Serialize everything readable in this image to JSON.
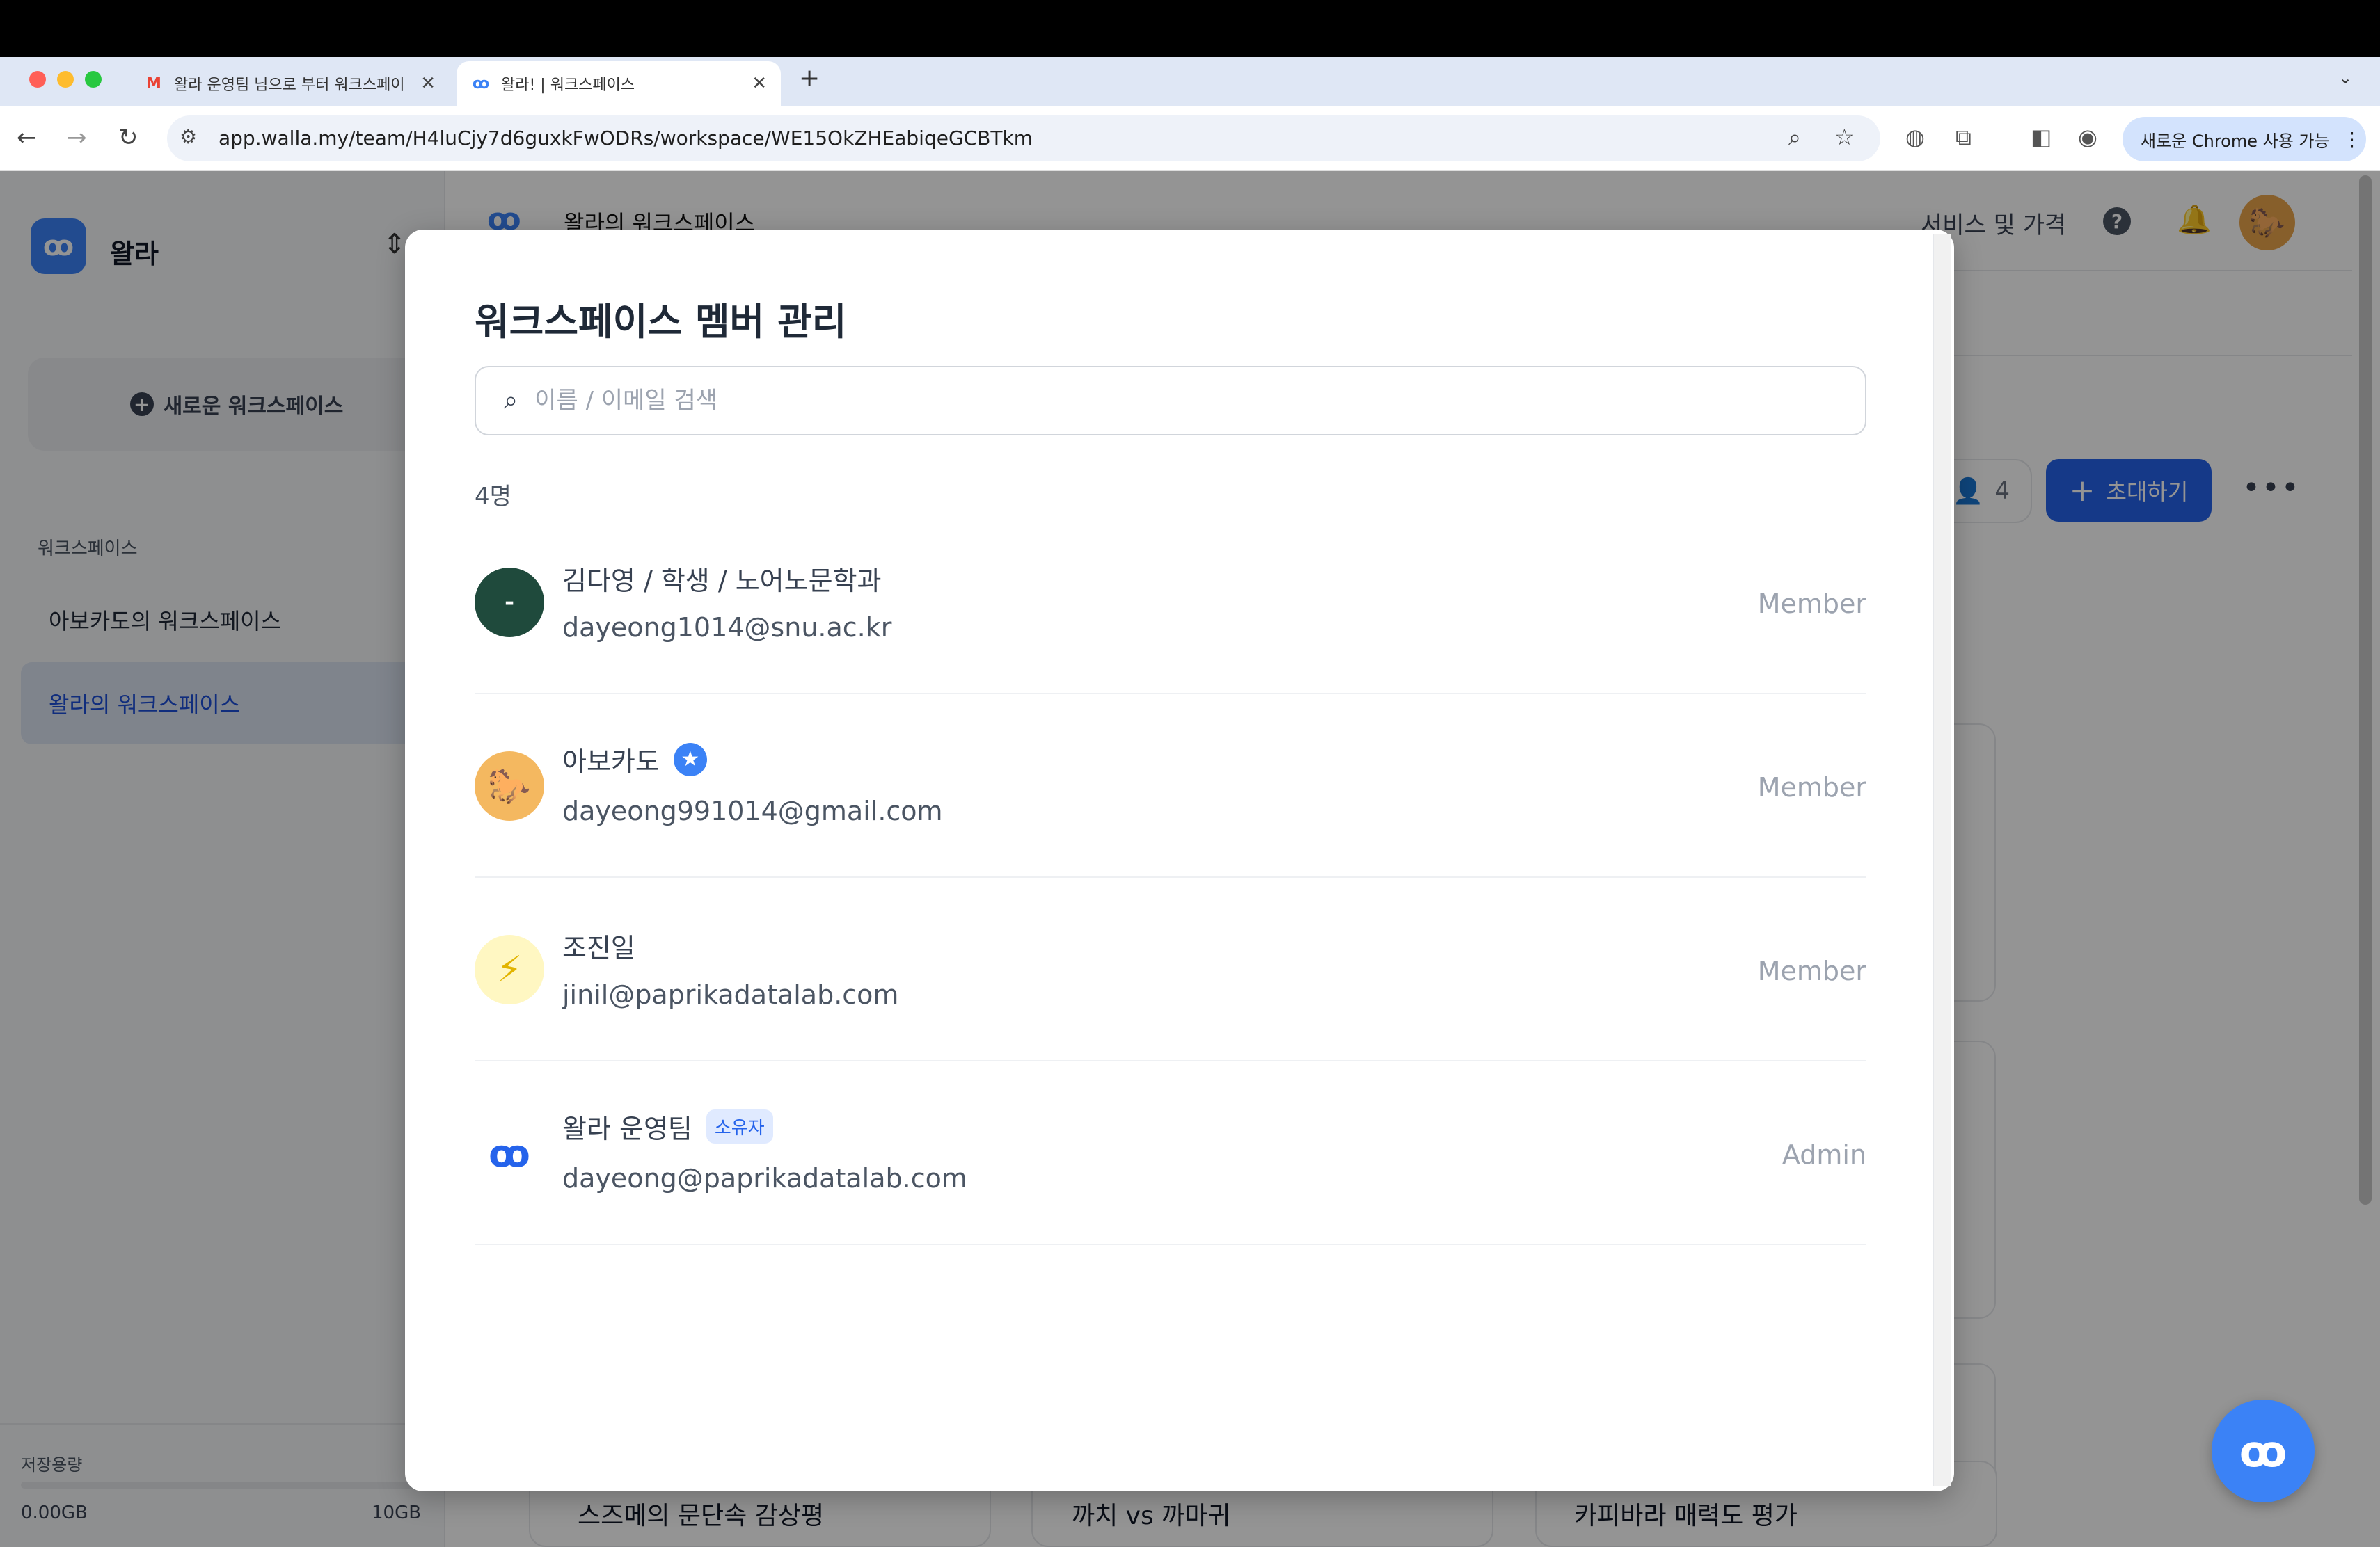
{
  "browser": {
    "tabs": [
      {
        "title": "왈라 운영팀 님으로 부터 워크스페이",
        "favicon": "M"
      },
      {
        "title": "왈라! | 워크스페이스",
        "favicon": "ꝏ"
      }
    ],
    "url": "app.walla.my/team/H4luCjy7d6guxkFwODRs/workspace/WE15OkZHEabiqeGCBTkm",
    "chrome_button": "새로운 Chrome 사용 가능"
  },
  "sidebar": {
    "logo_icon": "ꝏ",
    "brand": "왈라",
    "new_workspace": "새로운 워크스페이스",
    "section_label": "워크스페이스",
    "items": [
      {
        "label": "아보카도의 워크스페이스"
      },
      {
        "label": "왈라의 워크스페이스"
      }
    ],
    "storage_label": "저장용량",
    "storage_used": "0.00GB",
    "storage_total": "10GB",
    "storage_fraction": 0.0
  },
  "header": {
    "logo": "ꝏ",
    "workspace_title": "왈라의 워크스페이스",
    "pricing": "서비스 및 가격",
    "help": "?"
  },
  "toolbar": {
    "member_count": "4",
    "invite_label": "초대하기",
    "more": "•••"
  },
  "cards": [
    "스즈메의 문단속 감상평",
    "까치 vs 까마귀",
    "카피바라 매력도 평가"
  ],
  "fab_icon": "ꝏ",
  "modal": {
    "title": "워크스페이스 멤버 관리",
    "search_placeholder": "이름 / 이메일 검색",
    "count": "4명",
    "members": [
      {
        "name": "김다영 / 학생 / 노어노문학과",
        "email": "dayeong1014@snu.ac.kr",
        "role": "Member",
        "avatar": "-"
      },
      {
        "name": "아보카도",
        "email": "dayeong991014@gmail.com",
        "role": "Member",
        "avatar": "🐎",
        "badge": "★"
      },
      {
        "name": "조진일",
        "email": "jinil@paprikadatalab.com",
        "role": "Member",
        "avatar": "⚡"
      },
      {
        "name": "왈라 운영팀",
        "email": "dayeong@paprikadatalab.com",
        "role": "Admin",
        "avatar": "ꝏ",
        "owner_badge": "소유자"
      }
    ]
  },
  "colors": {
    "accent": "#2563eb",
    "brand_blue": "#3b82f6",
    "selected_bg": "#dbe3f1"
  }
}
